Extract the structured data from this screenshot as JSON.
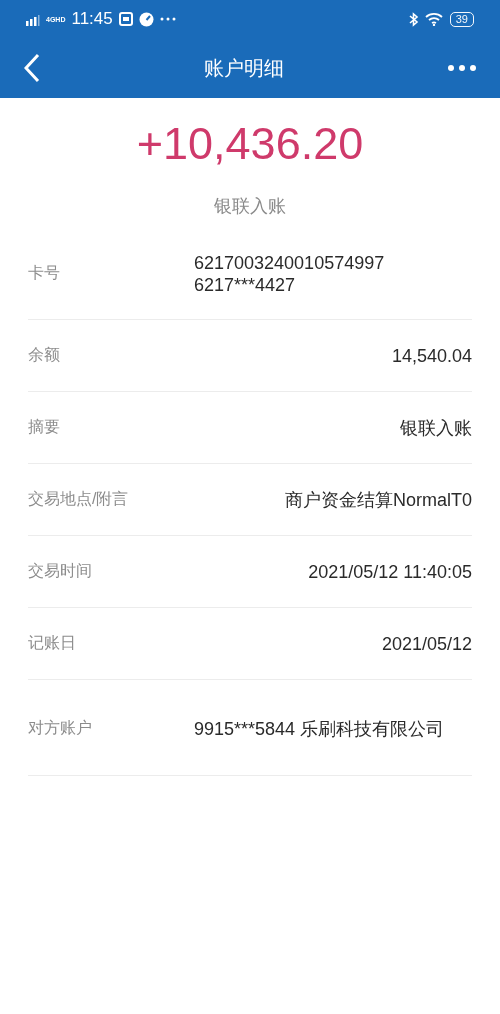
{
  "status_bar": {
    "network": "4GHD",
    "time": "11:45",
    "battery": "39"
  },
  "nav": {
    "title": "账户明细"
  },
  "amount": "+10,436.20",
  "summary": "银联入账",
  "details": [
    {
      "kind": "block",
      "label": "卡号",
      "lines": [
        "6217003240010574997",
        "6217***4427"
      ]
    },
    {
      "kind": "inline",
      "label": "余额",
      "lines": [
        "14,540.04"
      ]
    },
    {
      "kind": "inline",
      "label": "摘要",
      "lines": [
        "银联入账"
      ]
    },
    {
      "kind": "inline",
      "label": "交易地点/附言",
      "lines": [
        "商户资金结算NormalT0"
      ]
    },
    {
      "kind": "inline",
      "label": "交易时间",
      "lines": [
        "2021/05/12 11:40:05"
      ]
    },
    {
      "kind": "inline",
      "label": "记账日",
      "lines": [
        "2021/05/12"
      ]
    },
    {
      "kind": "block",
      "label": "对方账户",
      "lines": [
        "9915***5844 乐刷科技有限公司"
      ]
    }
  ]
}
